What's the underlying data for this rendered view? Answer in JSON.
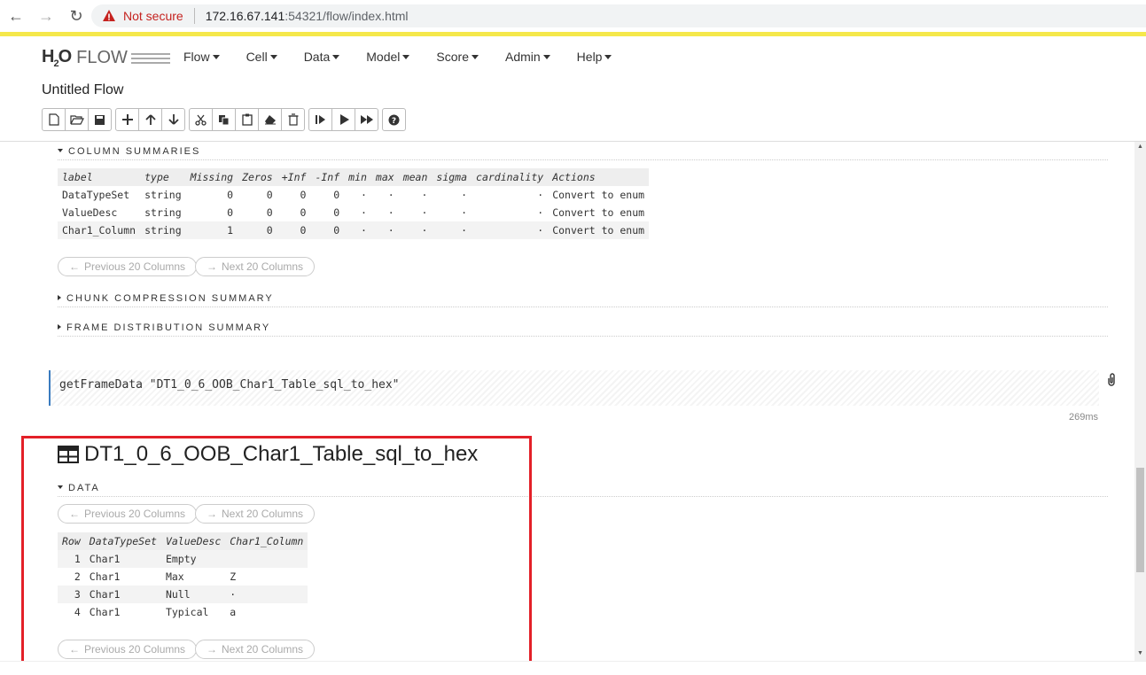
{
  "browser": {
    "security_label": "Not secure",
    "url_host": "172.16.67.141",
    "url_path": ":54321/flow/index.html"
  },
  "header": {
    "logo_text": "FLOW",
    "menu": [
      "Flow",
      "Cell",
      "Data",
      "Model",
      "Score",
      "Admin",
      "Help"
    ],
    "flow_title": "Untitled Flow"
  },
  "column_summaries": {
    "title": "COLUMN SUMMARIES",
    "headers": [
      "label",
      "type",
      "Missing",
      "Zeros",
      "+Inf",
      "-Inf",
      "min",
      "max",
      "mean",
      "sigma",
      "cardinality",
      "Actions"
    ],
    "rows": [
      [
        "DataTypeSet",
        "string",
        "0",
        "0",
        "0",
        "0",
        "·",
        "·",
        "·",
        "·",
        "·",
        "Convert to enum"
      ],
      [
        "ValueDesc",
        "string",
        "0",
        "0",
        "0",
        "0",
        "·",
        "·",
        "·",
        "·",
        "·",
        "Convert to enum"
      ],
      [
        "Char1_Column",
        "string",
        "1",
        "0",
        "0",
        "0",
        "·",
        "·",
        "·",
        "·",
        "·",
        "Convert to enum"
      ]
    ],
    "prev_label": "Previous 20 Columns",
    "next_label": "Next 20 Columns"
  },
  "chunk_summary": {
    "title": "CHUNK COMPRESSION SUMMARY"
  },
  "frame_distribution": {
    "title": "FRAME DISTRIBUTION SUMMARY"
  },
  "code_cell": {
    "code": "getFrameData \"DT1_0_6_OOB_Char1_Table_sql_to_hex\"",
    "timing": "269ms"
  },
  "frame": {
    "title": "DT1_0_6_OOB_Char1_Table_sql_to_hex",
    "data_section": "DATA",
    "prev_label": "Previous 20 Columns",
    "next_label": "Next 20 Columns",
    "headers": [
      "Row",
      "DataTypeSet",
      "ValueDesc",
      "Char1_Column"
    ],
    "rows": [
      [
        "1",
        "Char1",
        "Empty",
        ""
      ],
      [
        "2",
        "Char1",
        "Max",
        "Z"
      ],
      [
        "3",
        "Char1",
        "Null",
        "·"
      ],
      [
        "4",
        "Char1",
        "Typical",
        "a"
      ]
    ]
  },
  "colors": {
    "accent_link": "#3a7bbf",
    "highlight_box": "#e32028",
    "url_warning": "#c5221f",
    "top_stripe": "#f5e84a"
  }
}
